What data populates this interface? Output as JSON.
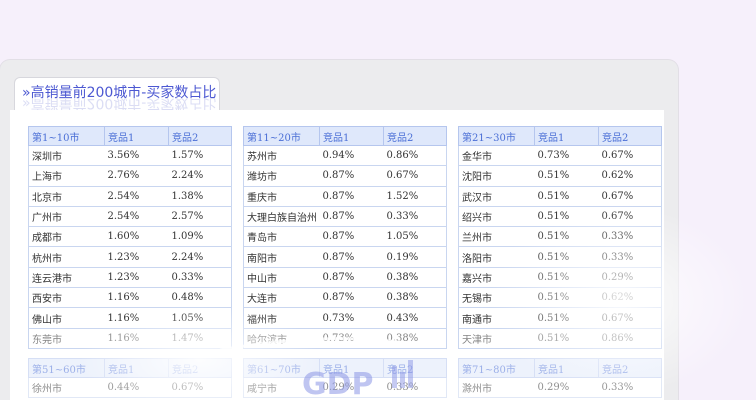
{
  "title": "»高销量前200城市-买家数占比",
  "tables": [
    {
      "headers": [
        "第1~10市",
        "竞品1",
        "竞品2"
      ],
      "rows": [
        [
          "深圳市",
          "3.56%",
          "1.57%"
        ],
        [
          "上海市",
          "2.76%",
          "2.24%"
        ],
        [
          "北京市",
          "2.54%",
          "1.38%"
        ],
        [
          "广州市",
          "2.54%",
          "2.57%"
        ],
        [
          "成都市",
          "1.60%",
          "1.09%"
        ],
        [
          "杭州市",
          "1.23%",
          "2.24%"
        ],
        [
          "连云港市",
          "1.23%",
          "0.33%"
        ],
        [
          "西安市",
          "1.16%",
          "0.48%"
        ],
        [
          "佛山市",
          "1.16%",
          "1.05%"
        ],
        [
          "东莞市",
          "1.16%",
          "1.47%"
        ]
      ]
    },
    {
      "headers": [
        "第11~20市",
        "竞品1",
        "竞品2"
      ],
      "rows": [
        [
          "苏州市",
          "0.94%",
          "0.86%"
        ],
        [
          "潍坊市",
          "0.87%",
          "0.67%"
        ],
        [
          "重庆市",
          "0.87%",
          "1.52%"
        ],
        [
          "大理白族自治州",
          "0.87%",
          "0.33%"
        ],
        [
          "青岛市",
          "0.87%",
          "1.05%"
        ],
        [
          "南阳市",
          "0.87%",
          "0.19%"
        ],
        [
          "中山市",
          "0.87%",
          "0.38%"
        ],
        [
          "大连市",
          "0.87%",
          "0.38%"
        ],
        [
          "福州市",
          "0.73%",
          "0.43%"
        ],
        [
          "哈尔滨市",
          "0.73%",
          "0.38%"
        ]
      ]
    },
    {
      "headers": [
        "第21~30市",
        "竞品1",
        "竞品2"
      ],
      "rows": [
        [
          "金华市",
          "0.73%",
          "0.67%"
        ],
        [
          "沈阳市",
          "0.51%",
          "0.62%"
        ],
        [
          "武汉市",
          "0.51%",
          "0.67%"
        ],
        [
          "绍兴市",
          "0.51%",
          "0.67%"
        ],
        [
          "兰州市",
          "0.51%",
          "0.33%"
        ],
        [
          "洛阳市",
          "0.51%",
          "0.33%"
        ],
        [
          "嘉兴市",
          "0.51%",
          "0.29%"
        ],
        [
          "无锡市",
          "0.51%",
          "0.62%"
        ],
        [
          "南通市",
          "0.51%",
          "0.67%"
        ],
        [
          "天津市",
          "0.51%",
          "0.86%"
        ]
      ]
    },
    {
      "headers": [
        "第51~60市",
        "竞品1",
        "竞品2"
      ],
      "rows": [
        [
          "徐州市",
          "0.44%",
          "0.67%"
        ]
      ]
    },
    {
      "headers": [
        "第61~70市",
        "竞品1",
        "竞品2"
      ],
      "rows": [
        [
          "咸宁市",
          "0.29%",
          "0.33%"
        ]
      ]
    },
    {
      "headers": [
        "第71~80市",
        "竞品1",
        "竞品2"
      ],
      "rows": [
        [
          "滁州市",
          "0.29%",
          "0.33%"
        ]
      ]
    }
  ],
  "watermark": "GDP"
}
